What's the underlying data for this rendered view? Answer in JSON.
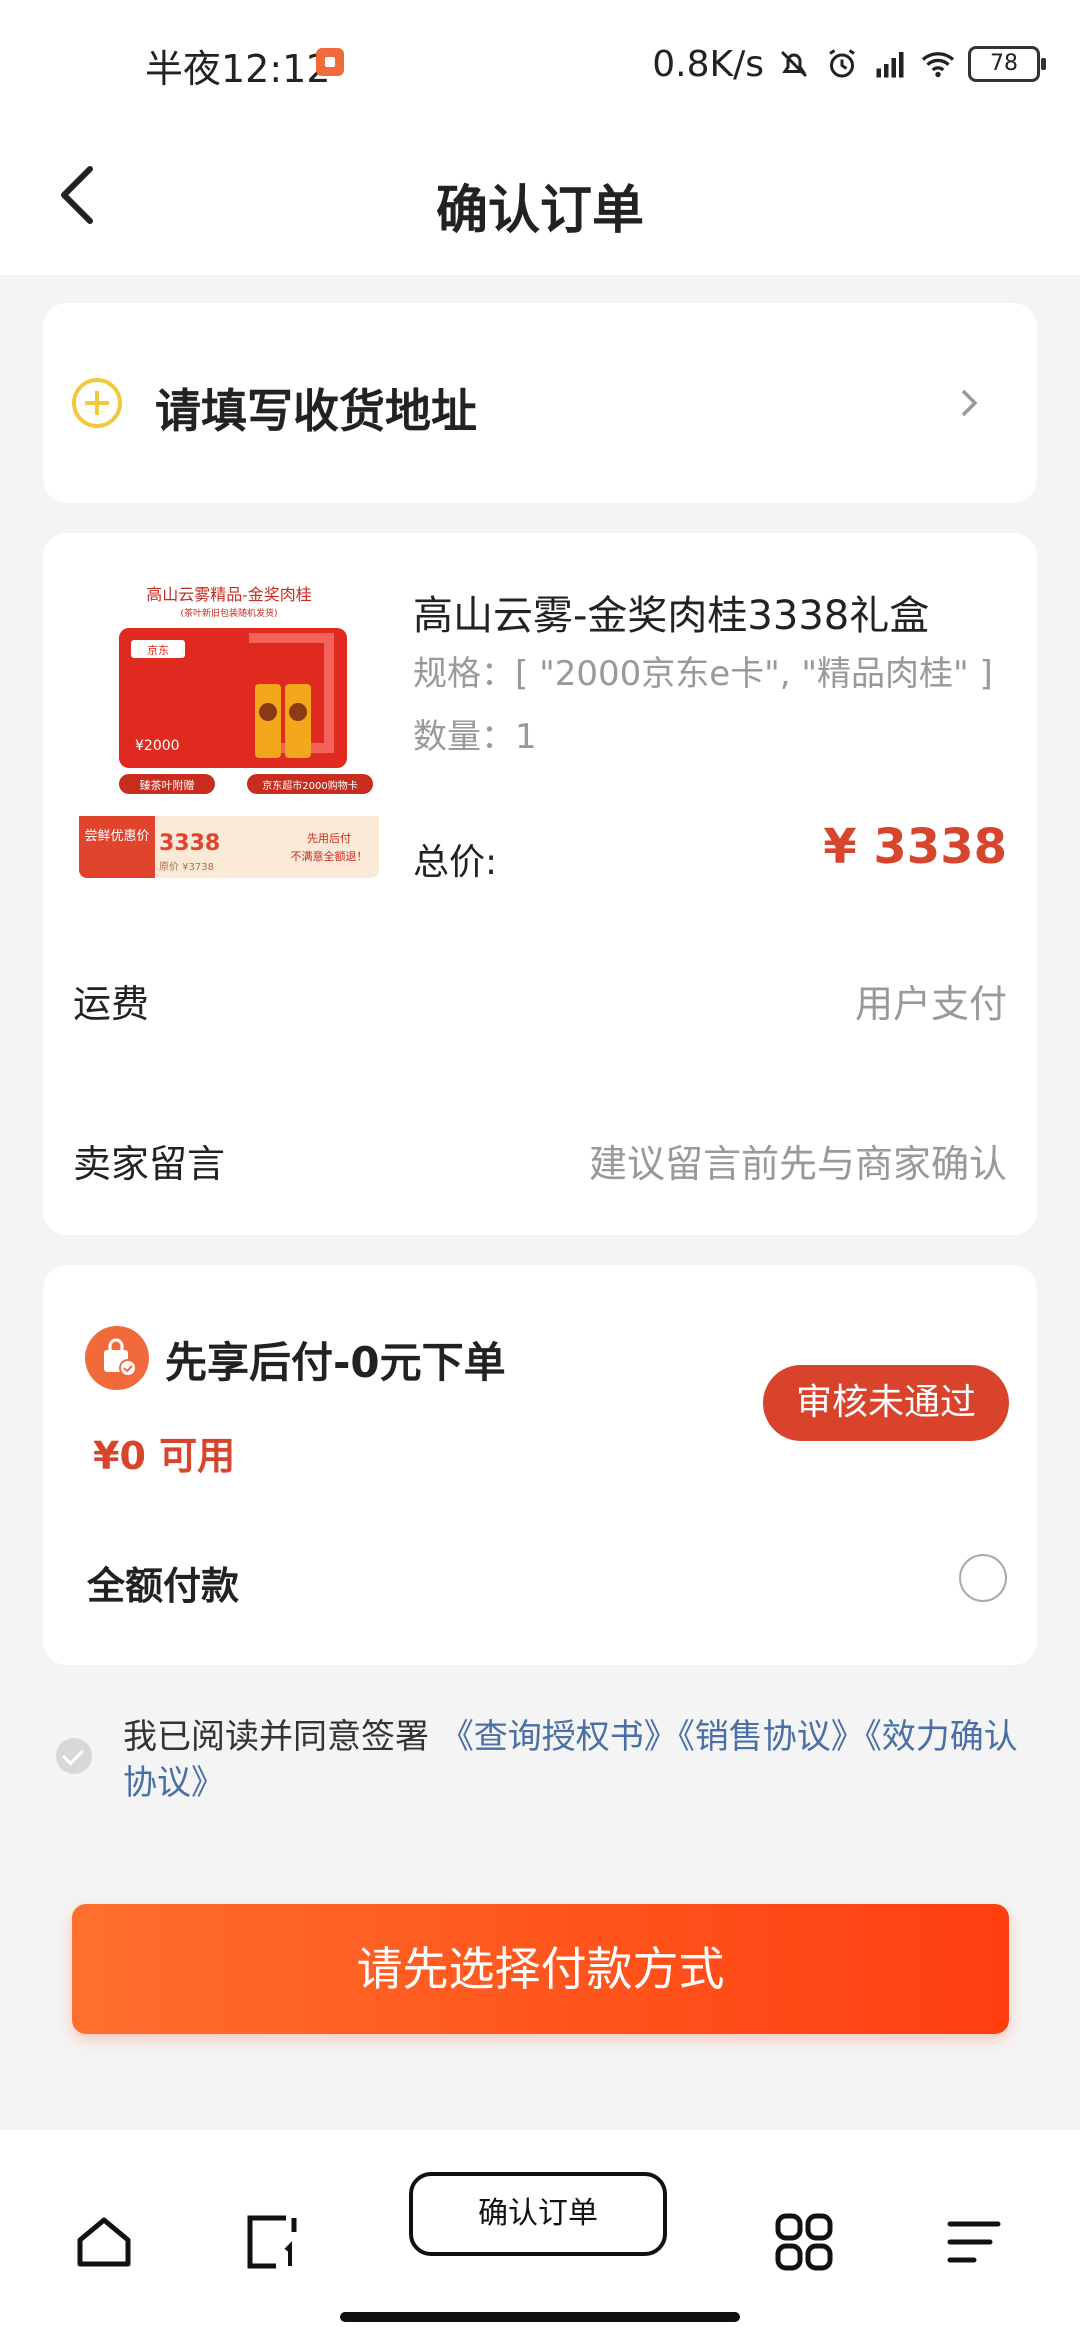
{
  "status_bar": {
    "time": "半夜12:12",
    "network_speed": "0.8K/s",
    "battery": "78"
  },
  "header": {
    "title": "确认订单",
    "back_icon": "chevron-left-icon"
  },
  "address": {
    "prompt": "请填写收货地址",
    "icon": "plus-circle-icon",
    "accent_color": "#f2c93c"
  },
  "product": {
    "image_texts": {
      "headline": "高山云雾精品-金奖肉桂",
      "subline": "(茶叶新旧包装随机发货)",
      "brand": "京东",
      "card_value": "¥2000",
      "tag_left": "臻茶叶附赠",
      "tag_right": "京东超市2000购物卡",
      "promo_label": "尝鲜优惠价",
      "promo_price": "3338",
      "original_price": "原价 ¥3738",
      "promo_right_line1": "先用后付",
      "promo_right_line2": "不满意全额退！"
    },
    "title": "高山云雾-金奖肉桂3338礼盒",
    "spec": "规格：[ \"2000京东e卡\", \"精品肉桂\" ]",
    "quantity": "数量：1",
    "total_label": "总价:",
    "total_value": "¥ 3338",
    "shipping_label": "运费",
    "shipping_value": "用户支付",
    "message_label": "卖家留言",
    "message_placeholder": "建议留言前先与商家确认"
  },
  "payment": {
    "option_title": "先享后付-0元下单",
    "option_icon": "shopping-bag-icon",
    "available": "¥0 可用",
    "status_badge": "审核未通过",
    "full_payment_label": "全额付款"
  },
  "agreement": {
    "prefix": "我已阅读并同意签署 ",
    "links": [
      "《查询授权书》",
      "《销售协议》",
      "《效力确认协议》"
    ]
  },
  "submit_label": "请先选择付款方式",
  "bottom_nav": {
    "center_label": "确认订单",
    "icons": [
      "home-icon",
      "tab-icon",
      "grid-icon",
      "menu-icon"
    ]
  },
  "colors": {
    "primary": "#ff4e1a",
    "price": "#d6452c",
    "link": "#4a6fa5"
  }
}
